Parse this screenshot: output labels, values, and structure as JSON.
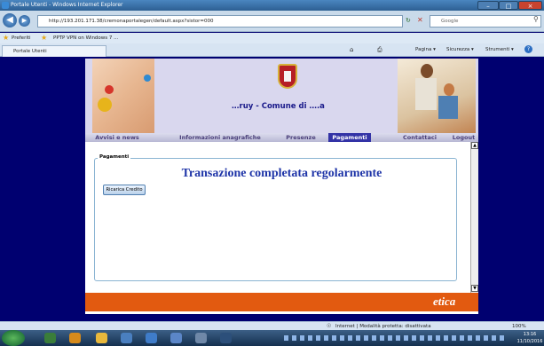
{
  "window": {
    "title": "Portale Utenti - Windows Internet Explorer",
    "minimize": "–",
    "maximize": "□",
    "close": "×"
  },
  "address_bar": {
    "url": "http://193.201.171.38/cremonaportalegen/default.aspx?sistor=000",
    "search_placeholder": "Google"
  },
  "favorites_bar": {
    "favorites_label": "Preferiti",
    "link_label": "PPTP VPN on Windows 7 ..."
  },
  "tab": {
    "label": "Portale Utenti"
  },
  "command_bar": {
    "pagina": "Pagina ▾",
    "sicurezza": "Sicurezza ▾",
    "strumenti": "Strumenti ▾"
  },
  "site": {
    "banner_title": "…ruy - Comune di ….a",
    "menu": [
      {
        "label": "Avvisi e news"
      },
      {
        "label": "Informazioni anagrafiche"
      },
      {
        "label": "Presenze"
      },
      {
        "label": "Pagamenti"
      },
      {
        "label": "Contattaci"
      },
      {
        "label": "Logout"
      }
    ],
    "panel_legend": "Pagamenti",
    "heading": "Transazione completata regolarmente",
    "recharge_button": "Ricarica Credito",
    "footer_logo": "etica"
  },
  "status_bar": {
    "zone": "Internet | Modalità protetta: disattivata",
    "zoom": "100%"
  },
  "taskbar": {
    "time": "13:16",
    "date": "11/10/2016"
  },
  "colors": {
    "page_background": "#000070",
    "heading_blue": "#1f35a8",
    "footer_orange": "#e25a10",
    "active_menu": "#3333a6"
  }
}
